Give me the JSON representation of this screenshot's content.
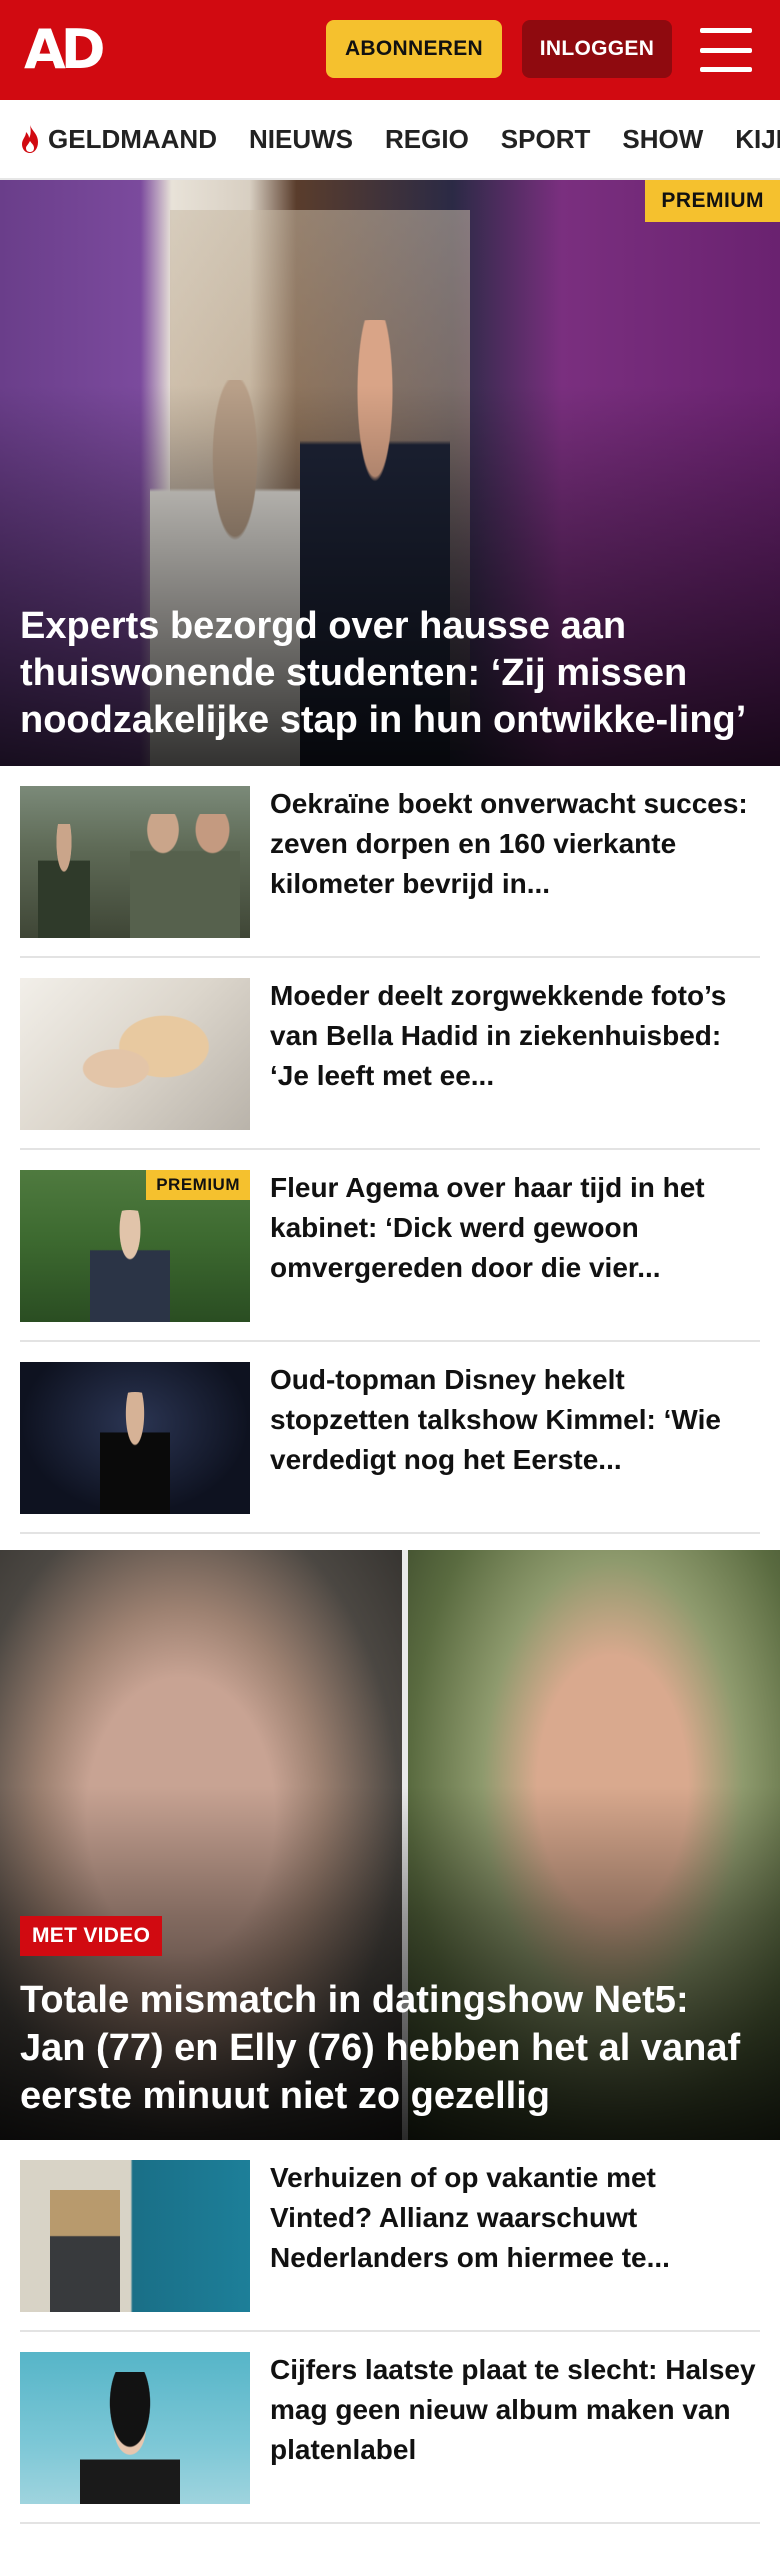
{
  "header": {
    "logo": "AD",
    "subscribe_label": "ABONNEREN",
    "login_label": "INLOGGEN"
  },
  "nav": {
    "items": [
      "GELDMAAND",
      "NIEUWS",
      "REGIO",
      "SPORT",
      "SHOW",
      "KIJK"
    ]
  },
  "hero": {
    "badge": "PREMIUM",
    "title": "Experts bezorgd over hausse aan thuiswonende studenten: ‘Zij missen noodzakelijke stap in hun ontwikke-ling’"
  },
  "articles_top": [
    {
      "title": "Oekraïne boekt onverwacht succes: zeven dorpen en 160 vierkante kilometer bevrijd in...",
      "badge": ""
    },
    {
      "title": "Moeder deelt zorgwekkende foto’s van Bella Hadid in ziekenhuisbed: ‘Je leeft met ee...",
      "badge": ""
    },
    {
      "title": "Fleur Agema over haar tijd in het kabinet: ‘Dick werd gewoon omvergereden door die vier...",
      "badge": "PREMIUM"
    },
    {
      "title": "Oud-topman Disney hekelt stopzetten talkshow Kimmel: ‘Wie verdedigt nog het Eerste...",
      "badge": ""
    }
  ],
  "feature": {
    "badge": "MET VIDEO",
    "title": "Totale mismatch in datingshow Net5: Jan (77) en Elly (76) hebben het al vanaf eerste minuut niet zo gezellig"
  },
  "articles_bottom": [
    {
      "title": "Verhuizen of op vakantie met Vinted? Allianz waarschuwt Nederlanders om hiermee te..."
    },
    {
      "title": "Cijfers laatste plaat te slecht: Halsey mag geen nieuw album maken van platenlabel"
    }
  ],
  "colors": {
    "brand_red": "#d10a11",
    "subscribe_yellow": "#f5c12e",
    "login_dark_red": "#8f0a0f"
  },
  "icons": {
    "menu": "hamburger-menu-icon",
    "flame": "flame-icon"
  }
}
